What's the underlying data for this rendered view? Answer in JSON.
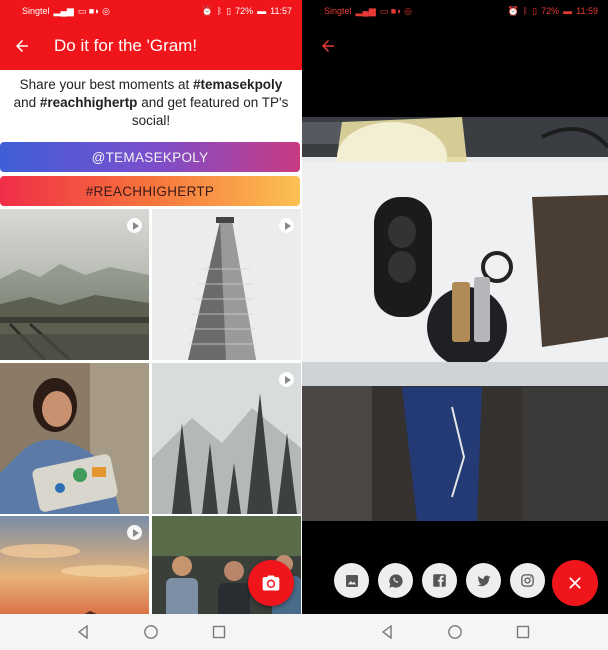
{
  "left_screen": {
    "status": {
      "carrier": "Singtel",
      "battery": "72%",
      "time": "11:57"
    },
    "appbar": {
      "title": "Do it for the 'Gram!"
    },
    "intro": {
      "part1": "Share your best moments at ",
      "hashtag1": "#temasekpoly",
      "part2": " and ",
      "hashtag2": "#reachhighertp",
      "part3": " and get featured on TP's social!"
    },
    "tag_buttons": [
      {
        "label": "@TEMASEKPOLY"
      },
      {
        "label": "#REACHHIGHERTP"
      }
    ],
    "grid": [
      {
        "icon": "misty-forest-photo",
        "video": true
      },
      {
        "icon": "flatiron-building-photo",
        "video": true
      },
      {
        "icon": "student-with-laptop-photo",
        "video": false
      },
      {
        "icon": "snowy-pines-photo",
        "video": true
      },
      {
        "icon": "sunset-clouds-photo",
        "video": true
      },
      {
        "icon": "panel-discussion-photo",
        "video": false
      }
    ],
    "camera_fab": {
      "icon": "camera-icon"
    }
  },
  "right_screen": {
    "status": {
      "carrier": "Singtel",
      "battery": "72%",
      "time": "11:59"
    },
    "photo": {
      "icon": "earbuds-and-keys-photo"
    },
    "share_buttons": [
      {
        "icon": "gallery-icon"
      },
      {
        "icon": "whatsapp-icon"
      },
      {
        "icon": "facebook-icon"
      },
      {
        "icon": "twitter-icon"
      },
      {
        "icon": "instagram-icon"
      }
    ],
    "close_fab": {
      "icon": "close-icon"
    }
  },
  "colors": {
    "accent": "#f0141b"
  }
}
